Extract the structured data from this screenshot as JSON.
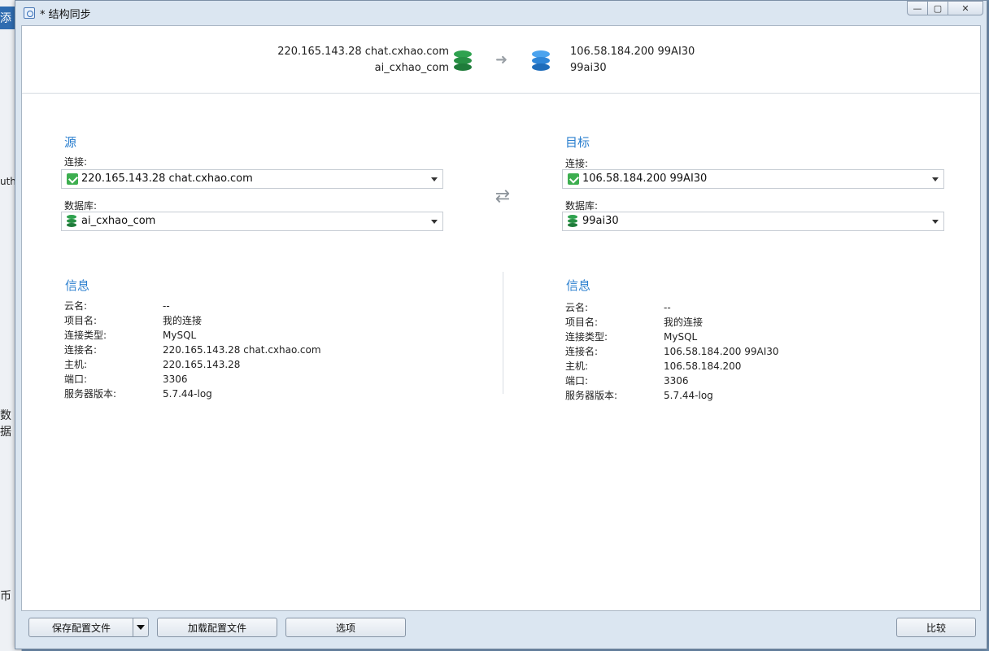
{
  "window": {
    "title": "* 结构同步",
    "minimize": "—",
    "maximize": "▢",
    "close": "✕"
  },
  "background_app": {
    "fragments": [
      "添",
      "uth",
      "数据",
      "币"
    ]
  },
  "header": {
    "source_connection": "220.165.143.28 chat.cxhao.com",
    "source_database": "ai_cxhao_com",
    "target_connection": "106.58.184.200 99AI30",
    "target_database": "99ai30",
    "source_db_color": "#2fa24f",
    "target_db_color": "#2f86d8"
  },
  "source": {
    "title": "源",
    "connection_label": "连接:",
    "connection_value": "220.165.143.28 chat.cxhao.com",
    "database_label": "数据库:",
    "database_value": "ai_cxhao_com",
    "info": {
      "title": "信息",
      "rows": [
        {
          "key": "云名:",
          "value": "--"
        },
        {
          "key": "项目名:",
          "value": "我的连接"
        },
        {
          "key": "连接类型:",
          "value": "MySQL"
        },
        {
          "key": "连接名:",
          "value": "220.165.143.28 chat.cxhao.com"
        },
        {
          "key": "主机:",
          "value": "220.165.143.28"
        },
        {
          "key": "端口:",
          "value": "3306"
        },
        {
          "key": "服务器版本:",
          "value": "5.7.44-log"
        }
      ]
    }
  },
  "target": {
    "title": "目标",
    "connection_label": "连接:",
    "connection_value": "106.58.184.200 99AI30",
    "database_label": "数据库:",
    "database_value": "99ai30",
    "info": {
      "title": "信息",
      "rows": [
        {
          "key": "云名:",
          "value": "--"
        },
        {
          "key": "项目名:",
          "value": "我的连接"
        },
        {
          "key": "连接类型:",
          "value": "MySQL"
        },
        {
          "key": "连接名:",
          "value": "106.58.184.200 99AI30"
        },
        {
          "key": "主机:",
          "value": "106.58.184.200"
        },
        {
          "key": "端口:",
          "value": "3306"
        },
        {
          "key": "服务器版本:",
          "value": "5.7.44-log"
        }
      ]
    }
  },
  "footer": {
    "save_profile": "保存配置文件",
    "load_profile": "加载配置文件",
    "options": "选项",
    "compare": "比较"
  },
  "colors": {
    "accent": "#2b7fcf",
    "connection_icon": "#3cae4f"
  }
}
